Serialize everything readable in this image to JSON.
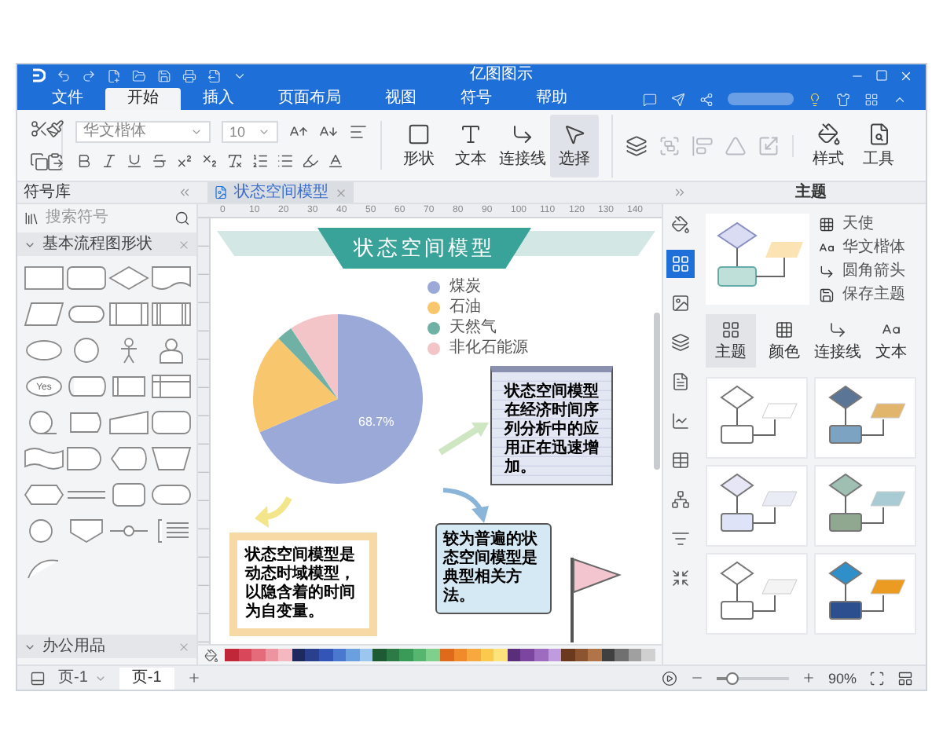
{
  "title_bar": {
    "title": "亿图图示"
  },
  "menu_tabs": [
    {
      "label": "文件",
      "selected": false
    },
    {
      "label": "开始",
      "selected": true
    },
    {
      "label": "插入",
      "selected": false
    },
    {
      "label": "页面布局",
      "selected": false
    },
    {
      "label": "视图",
      "selected": false
    },
    {
      "label": "符号",
      "selected": false
    },
    {
      "label": "帮助",
      "selected": false
    }
  ],
  "ribbon": {
    "font_name": "华文楷体",
    "font_size": "10",
    "draw_tools": [
      {
        "label": "形状",
        "selected": false
      },
      {
        "label": "文本",
        "selected": false
      },
      {
        "label": "连接线",
        "selected": false
      },
      {
        "label": "选择",
        "selected": true
      }
    ],
    "arrange_tools": [
      {
        "disabled": false
      },
      {
        "disabled": true
      },
      {
        "disabled": true
      },
      {
        "disabled": true
      },
      {
        "disabled": true
      }
    ],
    "style_tools": [
      "样式",
      "工具"
    ]
  },
  "symbol_library": {
    "title": "符号库",
    "search": {
      "placeholder": "搜索符号"
    },
    "categories": [
      "基本流程图形状",
      "办公用品"
    ],
    "yes_shape_label": "Yes"
  },
  "document_tabs": [
    {
      "label": "状态空间模型",
      "selected": true
    }
  ],
  "canvas": {
    "ruler_labels": [
      "0",
      "10",
      "20",
      "30",
      "40",
      "50",
      "60",
      "70",
      "80",
      "90",
      "100",
      "110",
      "120",
      "130",
      "140"
    ],
    "banner_title": "状态空间模型",
    "legend": [
      {
        "label": "煤炭",
        "color": "#9ba9d9"
      },
      {
        "label": "石油",
        "color": "#f8c66c"
      },
      {
        "label": "天然气",
        "color": "#6fb2a5"
      },
      {
        "label": "非化石能源",
        "color": "#f3c5c9"
      }
    ],
    "pie_label": "68.7%",
    "notes": [
      {
        "kind": "lined",
        "text": "状态空间模型在经济时间序列分析中的应用正在迅速增加。"
      },
      {
        "kind": "framed",
        "text": "状态空间模型是动态时域模型，以隐含着的时间为自变量。"
      },
      {
        "kind": "wavy",
        "text": "较为普遍的状态空间模型是典型相关方法。"
      }
    ]
  },
  "side_tools": [
    {
      "selected": false
    },
    {
      "selected": true
    },
    {
      "selected": false
    },
    {
      "selected": false
    },
    {
      "selected": false
    },
    {
      "selected": false
    },
    {
      "selected": false
    },
    {
      "selected": false
    },
    {
      "selected": false
    },
    {
      "selected": false
    }
  ],
  "theme_panel": {
    "title": "主题",
    "options": [
      "天使",
      "华文楷体",
      "圆角箭头",
      "保存主题"
    ],
    "tabs": [
      {
        "label": "主题",
        "selected": true
      },
      {
        "label": "颜色",
        "selected": false
      },
      {
        "label": "连接线",
        "selected": false
      },
      {
        "label": "文本",
        "selected": false
      }
    ]
  },
  "status_bar": {
    "page_select": "页-1",
    "page_tabs": [
      {
        "label": "页-1",
        "selected": true
      }
    ],
    "zoom": {
      "level": 0.22,
      "reading": "90%"
    }
  }
}
